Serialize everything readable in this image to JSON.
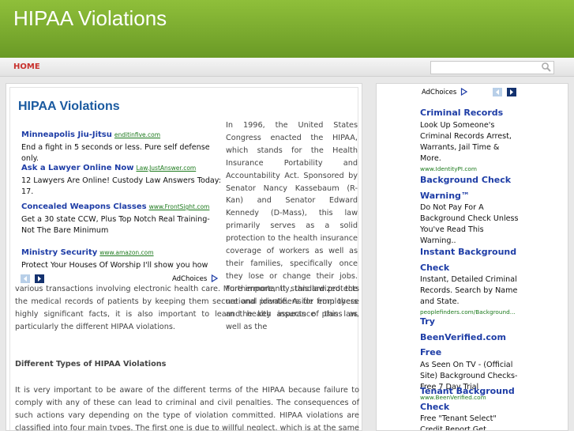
{
  "site": {
    "title": "HIPAA Violations"
  },
  "nav": {
    "home_label": "HOME"
  },
  "search": {
    "placeholder": "",
    "value": ""
  },
  "article": {
    "title": "HIPAA Violations",
    "intro_side": "In 1996, the United States Congress enacted the HIPAA, which stands for the Health Insurance Portability and Accountability Act. Sponsored by Senator Nancy Kassebaum (R-Kan) and Senator Edward Kennedy (D-Mass), this law primarily serves as a solid protection to the health insurance coverage of workers as well as their families, specifically once they lose or change their jobs. Furthermore, it standardized the national identifiers for employers and health insurance plans as well as the",
    "intro_full": "various transactions involving electronic health care. More importantly, this law protects the medical records of patients by keeping them secure and private. Aside from these highly significant facts, it is also important to learn the key aspects of this law, particularly the different HIPAA violations.",
    "subheading": "Different Types of HIPAA Violations",
    "paragraph2": "It is very important to be aware of the different terms of the HIPAA because failure to comply with any of these can lead to criminal and civil penalties. The consequences of such actions vary depending on the type of violation committed. HIPAA violations are classified into four main types. The first one is due to willful neglect, which is at the same time not corrected. The second"
  },
  "inline_ads": {
    "adchoices_label": "AdChoices",
    "items": [
      {
        "title": "Minneapolis Jiu-Jitsu",
        "url": "enditinfive.com",
        "text": "End a fight in 5 seconds or less. Pure self defense only."
      },
      {
        "title": "Ask a Lawyer Online Now",
        "url": "Law.JustAnswer.com",
        "text": "12 Lawyers Are Online! Custody Law Answers Today: 17."
      },
      {
        "title": "Concealed Weapons Classes",
        "url": "www.FrontSight.com",
        "text": "Get a 30 state CCW, Plus Top Notch Real Training- Not The Bare Minimum"
      },
      {
        "title": "Ministry Security",
        "url": "www.amazon.com",
        "text": "Protect Your Houses Of Worship I'll show you how"
      }
    ]
  },
  "sidebar_ads": {
    "adchoices_label": "AdChoices",
    "items": [
      {
        "title": "Criminal Records",
        "text": "Look Up Someone's Criminal Records Arrest, Warrants, Jail Time & More.",
        "url": "www.IdentityPI.com"
      },
      {
        "title": "Background Check Warning™",
        "text": "Do Not Pay For A Background Check Unless You've Read This Warning..",
        "url": ""
      },
      {
        "title": "Instant Background Check",
        "text": "Instant, Detailed Criminal Records. Search by Name and State.",
        "url": "peoplefinders.com/Background..."
      },
      {
        "title": "Try BeenVerified.com Free",
        "text": "As Seen On TV - (Official Site) Background Checks-Free 7 Day Trial",
        "url": "www.BeenVerified.com"
      },
      {
        "title": "Tenant Background Check",
        "text": "Free \"Tenant Select\" Credit Report Get Eviction, Criminal, & More",
        "url": ""
      }
    ]
  },
  "colors": {
    "header_green": "#7aac2e",
    "nav_home": "#c8302c",
    "title_blue": "#1a5aa0",
    "ad_link": "#1e3da6",
    "ad_url": "#1d7a1d"
  }
}
